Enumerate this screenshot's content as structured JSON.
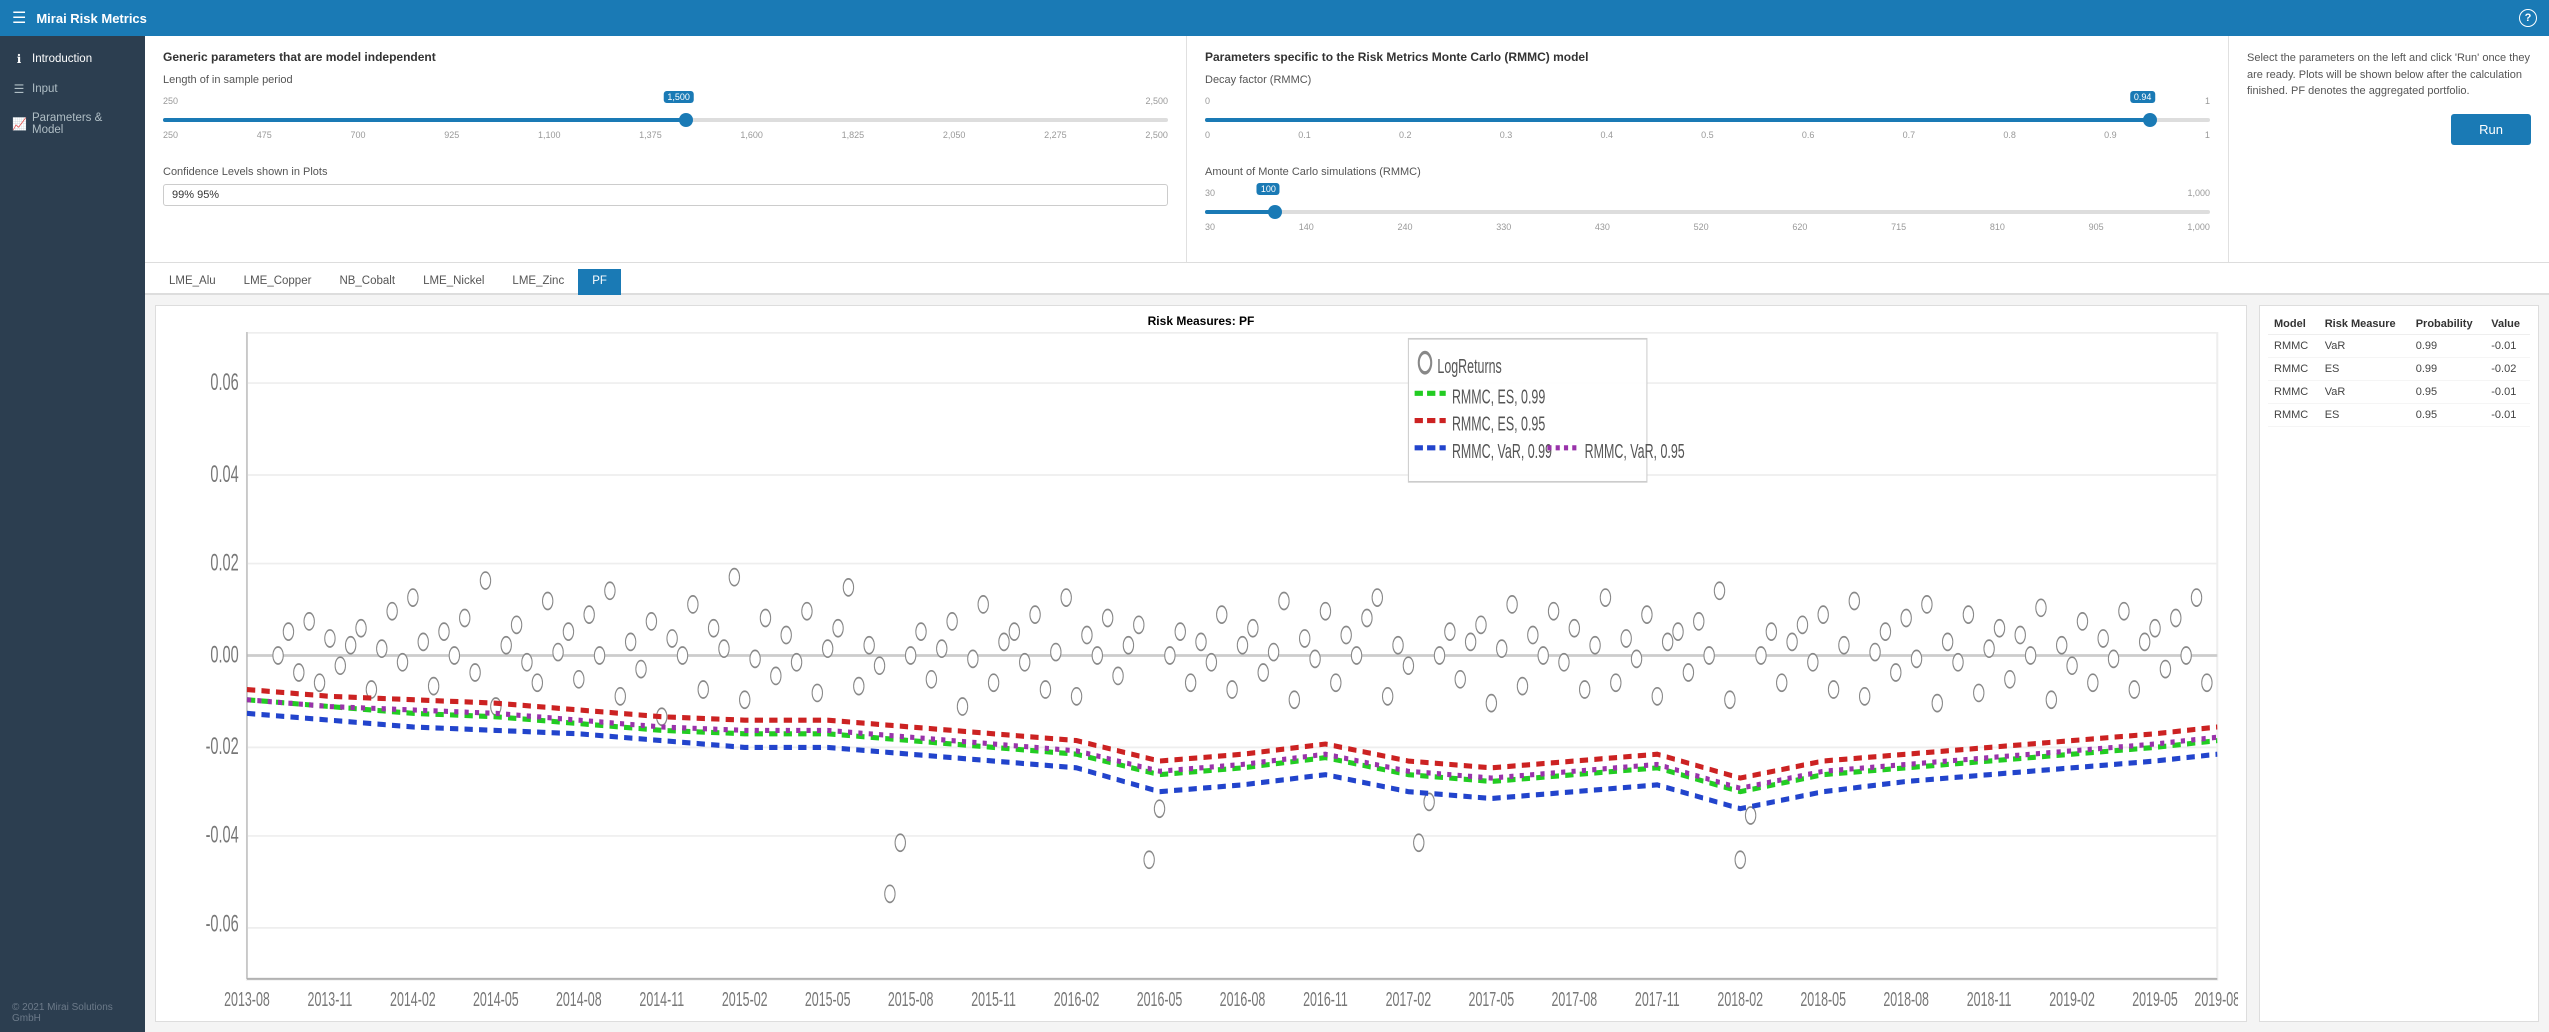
{
  "app": {
    "title": "Mirai Risk Metrics",
    "help_icon": "?"
  },
  "sidebar": {
    "items": [
      {
        "id": "introduction",
        "label": "Introduction",
        "icon": "ℹ",
        "active": true
      },
      {
        "id": "input",
        "label": "Input",
        "icon": "☰",
        "active": false
      },
      {
        "id": "parameters-model",
        "label": "Parameters & Model",
        "icon": "📈",
        "active": false
      }
    ],
    "footer": "© 2021 Mirai Solutions GmbH"
  },
  "generic_params": {
    "title": "Generic parameters that are model independent",
    "in_sample_label": "Length of in sample period",
    "in_sample_min": "250",
    "in_sample_max": "2,500",
    "in_sample_value": "1,500",
    "in_sample_pct": 52,
    "in_sample_ticks": [
      "250",
      "475",
      "700",
      "925",
      "1,100",
      "1,375",
      "1,600",
      "1,825",
      "2,050",
      "2,275",
      "2,500"
    ],
    "conf_label": "Confidence Levels shown in Plots",
    "conf_value": "99% 95%"
  },
  "rmmc_params": {
    "title": "Parameters specific to the Risk Metrics Monte Carlo (RMMC) model",
    "decay_label": "Decay factor (RMMC)",
    "decay_min": "0",
    "decay_max": "1",
    "decay_value": "0.94",
    "decay_pct": 94,
    "decay_ticks": [
      "0",
      "0.1",
      "0.2",
      "0.3",
      "0.4",
      "0.5",
      "0.6",
      "0.7",
      "0.8",
      "0.9",
      "1"
    ],
    "montecarlo_label": "Amount of Monte Carlo simulations (RMMC)",
    "mc_min": "30",
    "mc_max": "1,000",
    "mc_value": "100",
    "mc_pct": 7,
    "mc_ticks": [
      "30",
      "140",
      "240",
      "330",
      "430",
      "520",
      "620",
      "715",
      "810",
      "905",
      "1,000"
    ]
  },
  "run_panel": {
    "description": "Select the parameters on the left and click 'Run' once they are ready. Plots will be shown below after the calculation finished. PF denotes the aggregated portfolio.",
    "button_label": "Run"
  },
  "tabs": [
    {
      "id": "lme-alu",
      "label": "LME_Alu",
      "active": false
    },
    {
      "id": "lme-copper",
      "label": "LME_Copper",
      "active": false
    },
    {
      "id": "nb-cobalt",
      "label": "NB_Cobalt",
      "active": false
    },
    {
      "id": "lme-nickel",
      "label": "LME_Nickel",
      "active": false
    },
    {
      "id": "lme-zinc",
      "label": "LME_Zinc",
      "active": false
    },
    {
      "id": "pf",
      "label": "PF",
      "active": true
    }
  ],
  "chart": {
    "title": "Risk Measures: PF",
    "legend": [
      {
        "label": "LogReturns",
        "color": "#888",
        "style": "dot"
      },
      {
        "label": "RMMC, ES, 0.99",
        "color": "#22aa22",
        "style": "dashed"
      },
      {
        "label": "RMMC, ES, 0.95",
        "color": "#ff4444",
        "style": "dashed"
      },
      {
        "label": "RMMC, VaR, 0.99",
        "color": "#2255cc",
        "style": "dashed"
      },
      {
        "label": "RMMC, VaR, 0.95",
        "color": "#aa44aa",
        "style": "dashed"
      }
    ],
    "y_ticks": [
      "0.06",
      "0.04",
      "0.02",
      "0.00",
      "-0.02",
      "-0.04",
      "-0.06"
    ],
    "x_ticks": [
      "2013-08",
      "2013-11",
      "2014-02",
      "2014-05",
      "2014-08",
      "2014-11",
      "2015-02",
      "2015-05",
      "2015-08",
      "2015-11",
      "2016-02",
      "2016-05",
      "2016-08",
      "2016-11",
      "2017-02",
      "2017-05",
      "2017-08",
      "2017-11",
      "2018-02",
      "2018-05",
      "2018-08",
      "2018-11",
      "2019-02",
      "2019-05",
      "2019-08"
    ]
  },
  "risk_table": {
    "headers": [
      "Model",
      "Risk Measure",
      "Probability",
      "Value"
    ],
    "rows": [
      {
        "model": "RMMC",
        "measure": "VaR",
        "probability": "0.99",
        "value": "-0.01"
      },
      {
        "model": "RMMC",
        "measure": "ES",
        "probability": "0.99",
        "value": "-0.02"
      },
      {
        "model": "RMMC",
        "measure": "VaR",
        "probability": "0.95",
        "value": "-0.01"
      },
      {
        "model": "RMMC",
        "measure": "ES",
        "probability": "0.95",
        "value": "-0.01"
      }
    ]
  }
}
